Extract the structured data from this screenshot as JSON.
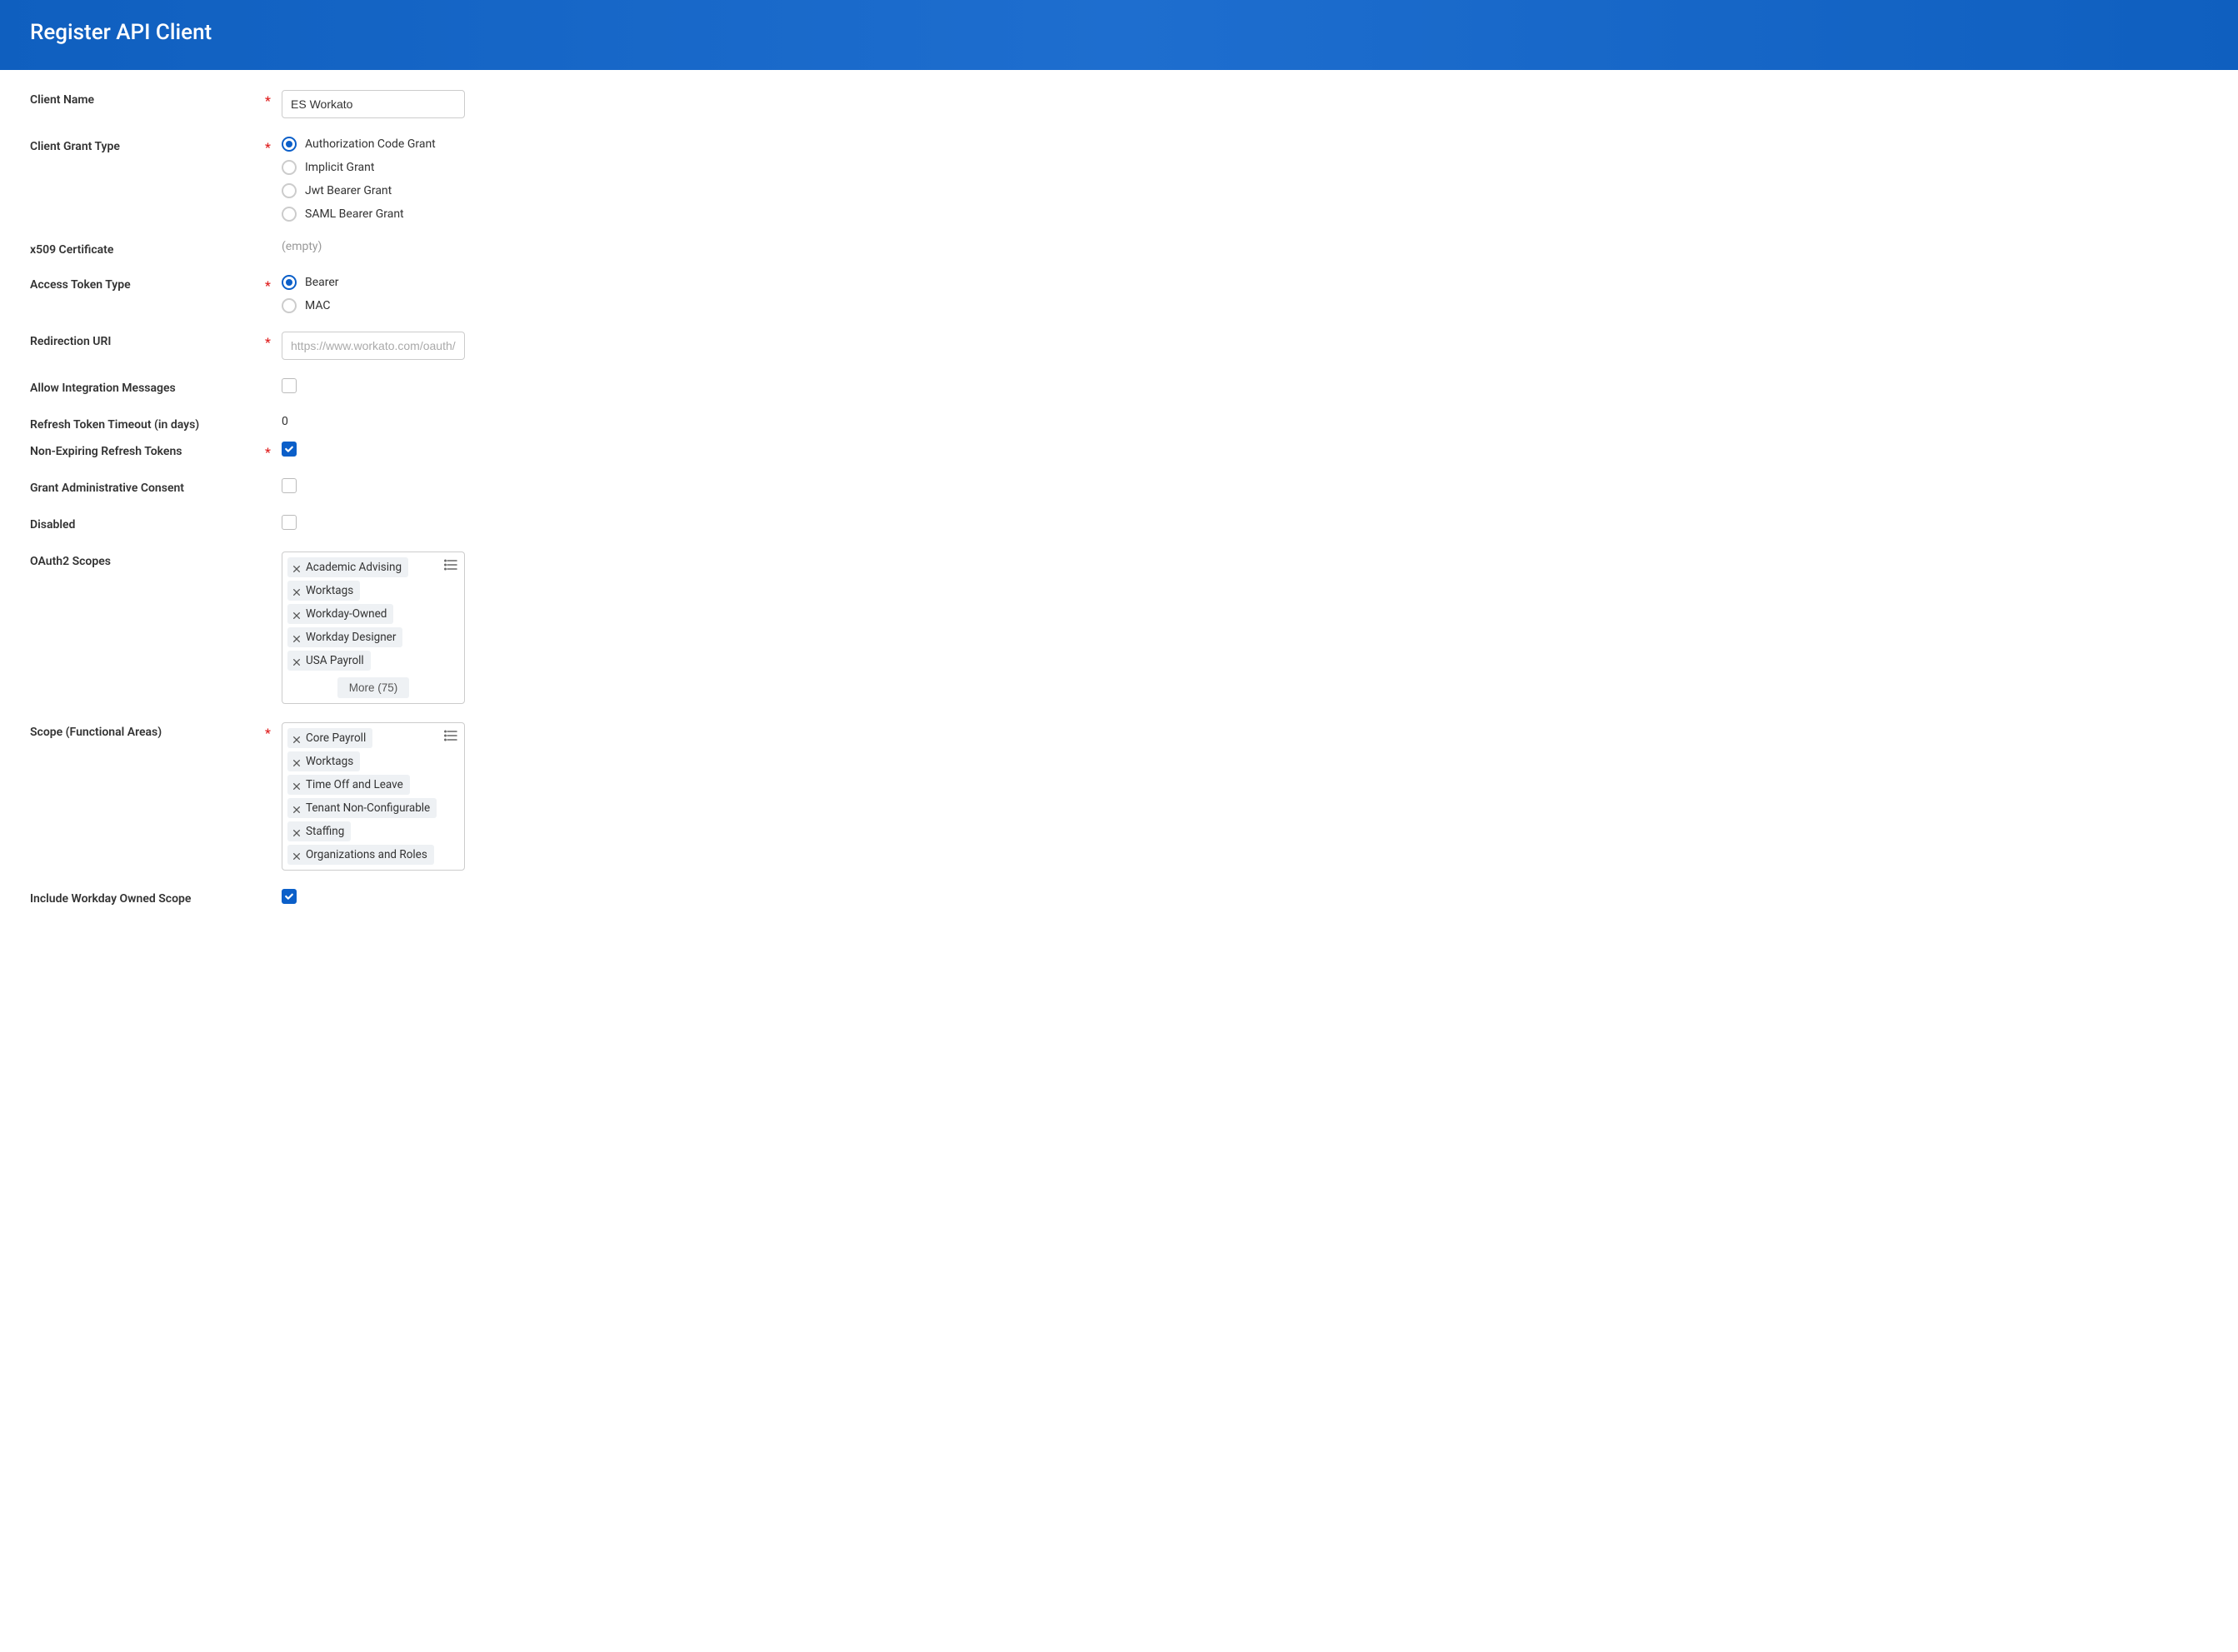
{
  "header": {
    "title": "Register API Client"
  },
  "required_marker": "*",
  "fields": {
    "client_name": {
      "label": "Client Name",
      "value": "ES Workato"
    },
    "client_grant_type": {
      "label": "Client Grant Type",
      "options": [
        "Authorization Code Grant",
        "Implicit Grant",
        "Jwt Bearer Grant",
        "SAML Bearer Grant"
      ],
      "selected": "Authorization Code Grant"
    },
    "x509_certificate": {
      "label": "x509 Certificate",
      "value_text": "(empty)"
    },
    "access_token_type": {
      "label": "Access Token Type",
      "options": [
        "Bearer",
        "MAC"
      ],
      "selected": "Bearer"
    },
    "redirection_uri": {
      "label": "Redirection URI",
      "placeholder": "https://www.workato.com/oauth/callba"
    },
    "allow_integration_messages": {
      "label": "Allow Integration Messages",
      "checked": false
    },
    "refresh_token_timeout": {
      "label": "Refresh Token Timeout (in days)",
      "value": "0"
    },
    "non_expiring_refresh_tokens": {
      "label": "Non-Expiring Refresh Tokens",
      "checked": true
    },
    "grant_admin_consent": {
      "label": "Grant Administrative Consent",
      "checked": false
    },
    "disabled": {
      "label": "Disabled",
      "checked": false
    },
    "oauth2_scopes": {
      "label": "OAuth2 Scopes",
      "tags": [
        "Academic Advising",
        "Worktags",
        "Workday-Owned",
        "Workday Designer",
        "USA Payroll"
      ],
      "more_label": "More (75)"
    },
    "scope_functional_areas": {
      "label": "Scope (Functional Areas)",
      "tags": [
        "Core Payroll",
        "Worktags",
        "Time Off and Leave",
        "Tenant Non-Configurable",
        "Staffing",
        "Organizations and Roles"
      ]
    },
    "include_workday_owned_scope": {
      "label": "Include Workday Owned Scope",
      "checked": true
    }
  }
}
